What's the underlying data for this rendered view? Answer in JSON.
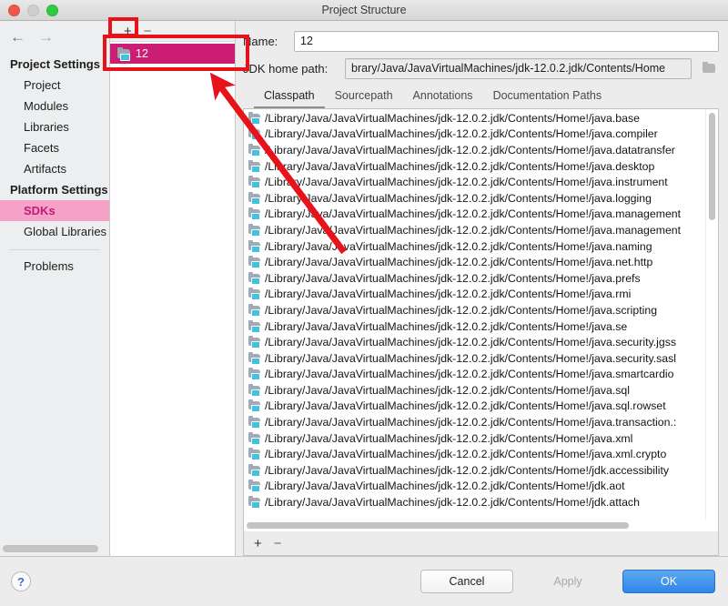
{
  "window": {
    "title": "Project Structure",
    "traffic_lights": [
      "close-button",
      "minimize-button",
      "zoom-button"
    ]
  },
  "nav": {
    "back_icon": "←",
    "forward_icon": "→",
    "groups": [
      {
        "title": "Project Settings",
        "items": [
          {
            "label": "Project",
            "selected": false
          },
          {
            "label": "Modules",
            "selected": false
          },
          {
            "label": "Libraries",
            "selected": false
          },
          {
            "label": "Facets",
            "selected": false
          },
          {
            "label": "Artifacts",
            "selected": false
          }
        ]
      },
      {
        "title": "Platform Settings",
        "items": [
          {
            "label": "SDKs",
            "selected": true
          },
          {
            "label": "Global Libraries",
            "selected": false
          }
        ]
      }
    ],
    "extra_items": [
      {
        "label": "Problems",
        "selected": false
      }
    ]
  },
  "sdk_panel": {
    "toolbar": {
      "add_label": "+",
      "remove_label": "−"
    },
    "items": [
      {
        "label": "12",
        "icon": "jdk-icon",
        "selected": true
      }
    ]
  },
  "detail": {
    "name_label": "Name:",
    "name_value": "12",
    "name_placeholder": "",
    "jdk_home_label": "JDK home path:",
    "jdk_home_value": "brary/Java/JavaVirtualMachines/jdk-12.0.2.jdk/Contents/Home",
    "browse_icon": "folder-icon",
    "tabs": [
      {
        "label": "Classpath",
        "active": true
      },
      {
        "label": "Sourcepath",
        "active": false
      },
      {
        "label": "Annotations",
        "active": false
      },
      {
        "label": "Documentation Paths",
        "active": false
      }
    ],
    "classpath_toolbar": {
      "add_label": "+",
      "remove_label": "−"
    },
    "classpath_entries": [
      "/Library/Java/JavaVirtualMachines/jdk-12.0.2.jdk/Contents/Home!/java.base",
      "/Library/Java/JavaVirtualMachines/jdk-12.0.2.jdk/Contents/Home!/java.compiler",
      "/Library/Java/JavaVirtualMachines/jdk-12.0.2.jdk/Contents/Home!/java.datatransfer",
      "/Library/Java/JavaVirtualMachines/jdk-12.0.2.jdk/Contents/Home!/java.desktop",
      "/Library/Java/JavaVirtualMachines/jdk-12.0.2.jdk/Contents/Home!/java.instrument",
      "/Library/Java/JavaVirtualMachines/jdk-12.0.2.jdk/Contents/Home!/java.logging",
      "/Library/Java/JavaVirtualMachines/jdk-12.0.2.jdk/Contents/Home!/java.management",
      "/Library/Java/JavaVirtualMachines/jdk-12.0.2.jdk/Contents/Home!/java.management",
      "/Library/Java/JavaVirtualMachines/jdk-12.0.2.jdk/Contents/Home!/java.naming",
      "/Library/Java/JavaVirtualMachines/jdk-12.0.2.jdk/Contents/Home!/java.net.http",
      "/Library/Java/JavaVirtualMachines/jdk-12.0.2.jdk/Contents/Home!/java.prefs",
      "/Library/Java/JavaVirtualMachines/jdk-12.0.2.jdk/Contents/Home!/java.rmi",
      "/Library/Java/JavaVirtualMachines/jdk-12.0.2.jdk/Contents/Home!/java.scripting",
      "/Library/Java/JavaVirtualMachines/jdk-12.0.2.jdk/Contents/Home!/java.se",
      "/Library/Java/JavaVirtualMachines/jdk-12.0.2.jdk/Contents/Home!/java.security.jgss",
      "/Library/Java/JavaVirtualMachines/jdk-12.0.2.jdk/Contents/Home!/java.security.sasl",
      "/Library/Java/JavaVirtualMachines/jdk-12.0.2.jdk/Contents/Home!/java.smartcardio",
      "/Library/Java/JavaVirtualMachines/jdk-12.0.2.jdk/Contents/Home!/java.sql",
      "/Library/Java/JavaVirtualMachines/jdk-12.0.2.jdk/Contents/Home!/java.sql.rowset",
      "/Library/Java/JavaVirtualMachines/jdk-12.0.2.jdk/Contents/Home!/java.transaction.:",
      "/Library/Java/JavaVirtualMachines/jdk-12.0.2.jdk/Contents/Home!/java.xml",
      "/Library/Java/JavaVirtualMachines/jdk-12.0.2.jdk/Contents/Home!/java.xml.crypto",
      "/Library/Java/JavaVirtualMachines/jdk-12.0.2.jdk/Contents/Home!/jdk.accessibility",
      "/Library/Java/JavaVirtualMachines/jdk-12.0.2.jdk/Contents/Home!/jdk.aot",
      "/Library/Java/JavaVirtualMachines/jdk-12.0.2.jdk/Contents/Home!/jdk.attach"
    ]
  },
  "footer": {
    "help_label": "?",
    "cancel_label": "Cancel",
    "apply_label": "Apply",
    "ok_label": "OK"
  },
  "annotations": {
    "accent_color": "#e8131a",
    "selection_color": "#cc1d74",
    "nav_selection_bg": "#f5a2c8",
    "ok_button_color": "#2f86e8"
  }
}
